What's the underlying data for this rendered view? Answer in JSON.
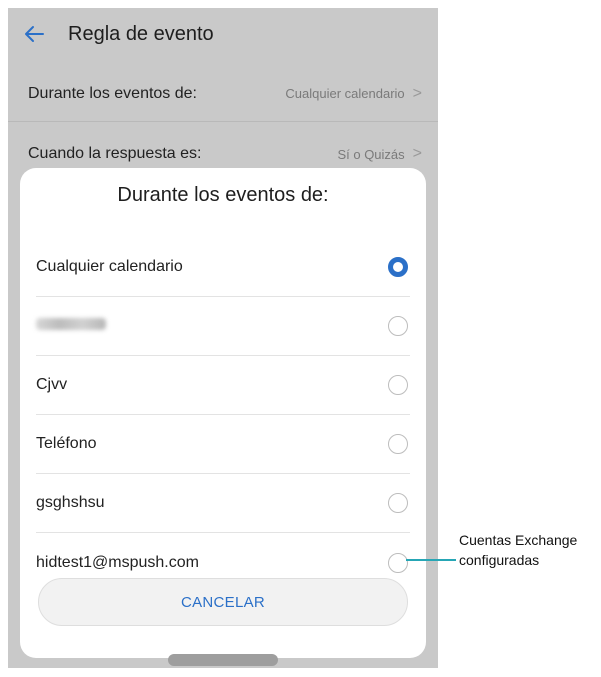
{
  "header": {
    "back_icon": "arrow-left-icon",
    "title": "Regla de evento"
  },
  "settings": [
    {
      "label": "Durante los eventos de:",
      "value": "Cualquier calendario"
    },
    {
      "label": "Cuando la respuesta es:",
      "value": "Sí o Quizás"
    }
  ],
  "dialog": {
    "title": "Durante los eventos de:",
    "options": [
      {
        "label": "Cualquier calendario",
        "selected": true
      },
      {
        "label": "",
        "selected": false
      },
      {
        "label": "Cjvv",
        "selected": false
      },
      {
        "label": "Teléfono",
        "selected": false
      },
      {
        "label": "gsghshsu",
        "selected": false
      },
      {
        "label": "hidtest1@mspush.com",
        "selected": false
      }
    ],
    "cancel_label": "CANCELAR"
  },
  "annotation": {
    "line1": "Cuentas Exchange",
    "line2": "configuradas"
  },
  "colors": {
    "accent": "#2b70c8",
    "callout": "#26a6b5",
    "dim_background": "#c9c9c9"
  }
}
